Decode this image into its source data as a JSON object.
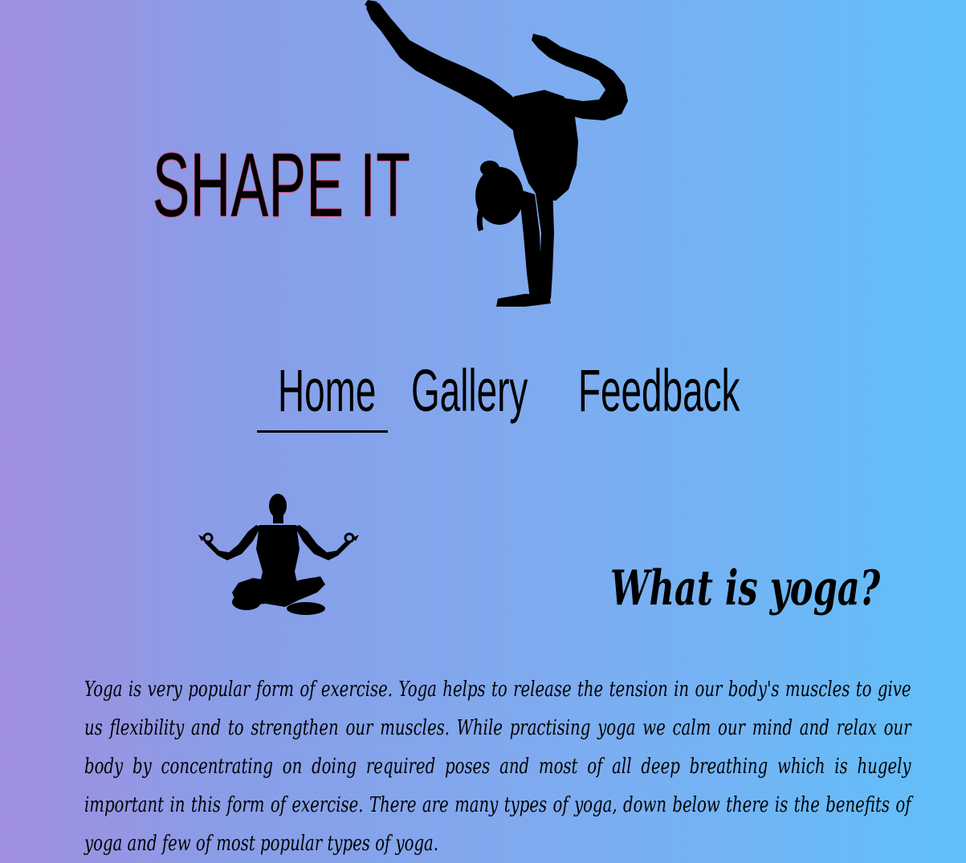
{
  "site": {
    "logo_text": "SHAPE IT"
  },
  "nav": {
    "items": [
      {
        "label": "Home",
        "active": true
      },
      {
        "label": "Gallery",
        "active": false
      },
      {
        "label": "Feedback",
        "active": false
      }
    ]
  },
  "intro": {
    "title": "What is yoga?",
    "body": "Yoga is very popular form of exercise. Yoga helps to release the tension in our body's muscles to give us flexibility and to strengthen our muscles. While practising yoga we calm our mind and relax our body by concentrating on doing required poses and most of all deep breathing which is hugely important in this form of exercise. There are many types of yoga, down below there is the benefits of yoga and few of most popular types of yoga."
  },
  "images": {
    "hero": "handstand-yoga-silhouette",
    "intro": "lotus-meditation-silhouette"
  },
  "colors": {
    "gradient_left": "#a08fdf",
    "gradient_right": "#60c0fa",
    "logo_outline": "#d23a6a",
    "text": "#000000"
  }
}
